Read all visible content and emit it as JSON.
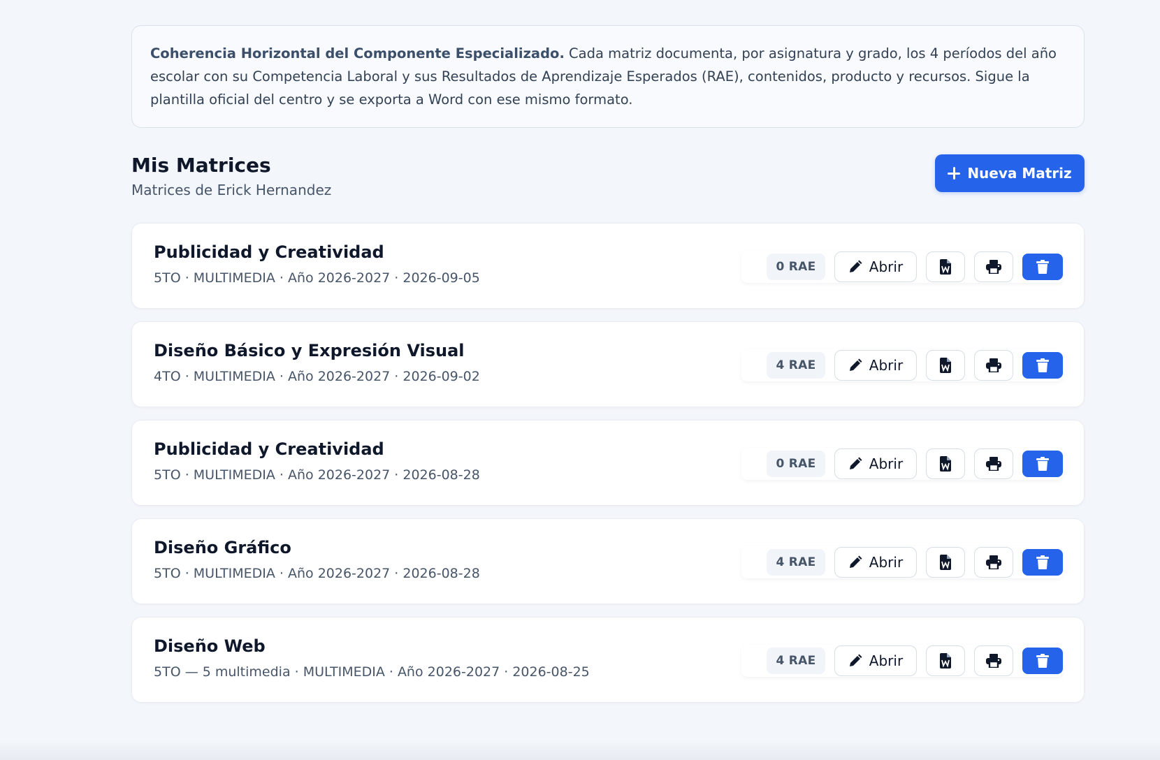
{
  "intro": {
    "bold": "Coherencia Horizontal del Componente Especializado.",
    "text": " Cada matriz documenta, por asignatura y grado, los 4 períodos del año escolar con su Competencia Laboral y sus Resultados de Aprendizaje Esperados (RAE), contenidos, producto y recursos. Sigue la plantilla oficial del centro y se exporta a Word con ese mismo formato."
  },
  "header": {
    "title": "Mis Matrices",
    "subtitle": "Matrices de Erick Hernandez",
    "new_button": "Nueva Matriz"
  },
  "actions": {
    "open_label": "Abrir"
  },
  "matrices": [
    {
      "title": "Publicidad y Creatividad",
      "meta": "5TO · MULTIMEDIA · Año 2026-2027 · 2026-09-05",
      "rae": "0 RAE"
    },
    {
      "title": "Diseño Básico y Expresión Visual",
      "meta": "4TO · MULTIMEDIA · Año 2026-2027 · 2026-09-02",
      "rae": "4 RAE"
    },
    {
      "title": "Publicidad y Creatividad",
      "meta": "5TO · MULTIMEDIA · Año 2026-2027 · 2026-08-28",
      "rae": "0 RAE"
    },
    {
      "title": "Diseño Gráfico",
      "meta": "5TO · MULTIMEDIA · Año 2026-2027 · 2026-08-28",
      "rae": "4 RAE"
    },
    {
      "title": "Diseño Web",
      "meta": "5TO — 5 multimedia · MULTIMEDIA · Año 2026-2027 · 2026-08-25",
      "rae": "4 RAE"
    }
  ],
  "icons": {
    "open": "pencil-icon",
    "word": "word-file-icon",
    "print": "printer-icon",
    "delete": "trash-icon",
    "new": "plus-icon"
  },
  "colors": {
    "primary": "#2563eb",
    "background": "#f3f6fb",
    "card": "#ffffff"
  }
}
